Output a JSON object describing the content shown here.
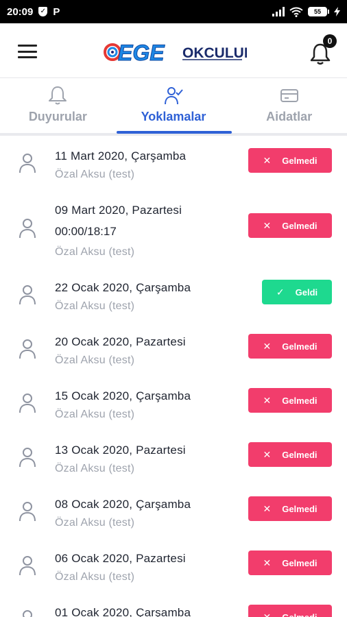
{
  "status_bar": {
    "time": "20:09",
    "battery": "55"
  },
  "header": {
    "logo_text": "EGE",
    "logo_sub": "OKCULUK",
    "notification_count": "0"
  },
  "tabs": [
    {
      "label": "Duyurular",
      "icon": "bell-icon"
    },
    {
      "label": "Yoklamalar",
      "icon": "user-check-icon"
    },
    {
      "label": "Aidatlar",
      "icon": "card-icon"
    }
  ],
  "active_tab": "Yoklamalar",
  "colors": {
    "accent": "#2f61d6",
    "absent": "#f23d6c",
    "present": "#1ed98f"
  },
  "records": [
    {
      "date": "11 Mart 2020, Çarşamba",
      "time": "",
      "user": "Özal Aksu (test)",
      "status": "Gelmedi",
      "status_glyph": "✕"
    },
    {
      "date": "09 Mart 2020, Pazartesi",
      "time": "00:00/18:17",
      "user": "Özal Aksu (test)",
      "status": "Gelmedi",
      "status_glyph": "✕"
    },
    {
      "date": "22 Ocak 2020, Çarşamba",
      "time": "",
      "user": "Özal Aksu (test)",
      "status": "Geldi",
      "status_glyph": "✓"
    },
    {
      "date": "20 Ocak 2020, Pazartesi",
      "time": "",
      "user": "Özal Aksu (test)",
      "status": "Gelmedi",
      "status_glyph": "✕"
    },
    {
      "date": "15 Ocak 2020, Çarşamba",
      "time": "",
      "user": "Özal Aksu (test)",
      "status": "Gelmedi",
      "status_glyph": "✕"
    },
    {
      "date": "13 Ocak 2020, Pazartesi",
      "time": "",
      "user": "Özal Aksu (test)",
      "status": "Gelmedi",
      "status_glyph": "✕"
    },
    {
      "date": "08 Ocak 2020, Çarşamba",
      "time": "",
      "user": "Özal Aksu (test)",
      "status": "Gelmedi",
      "status_glyph": "✕"
    },
    {
      "date": "06 Ocak 2020, Pazartesi",
      "time": "",
      "user": "Özal Aksu (test)",
      "status": "Gelmedi",
      "status_glyph": "✕"
    },
    {
      "date": "01 Ocak 2020, Çarşamba",
      "time": "",
      "user": "",
      "status": "Gelmedi",
      "status_glyph": "✕"
    }
  ]
}
